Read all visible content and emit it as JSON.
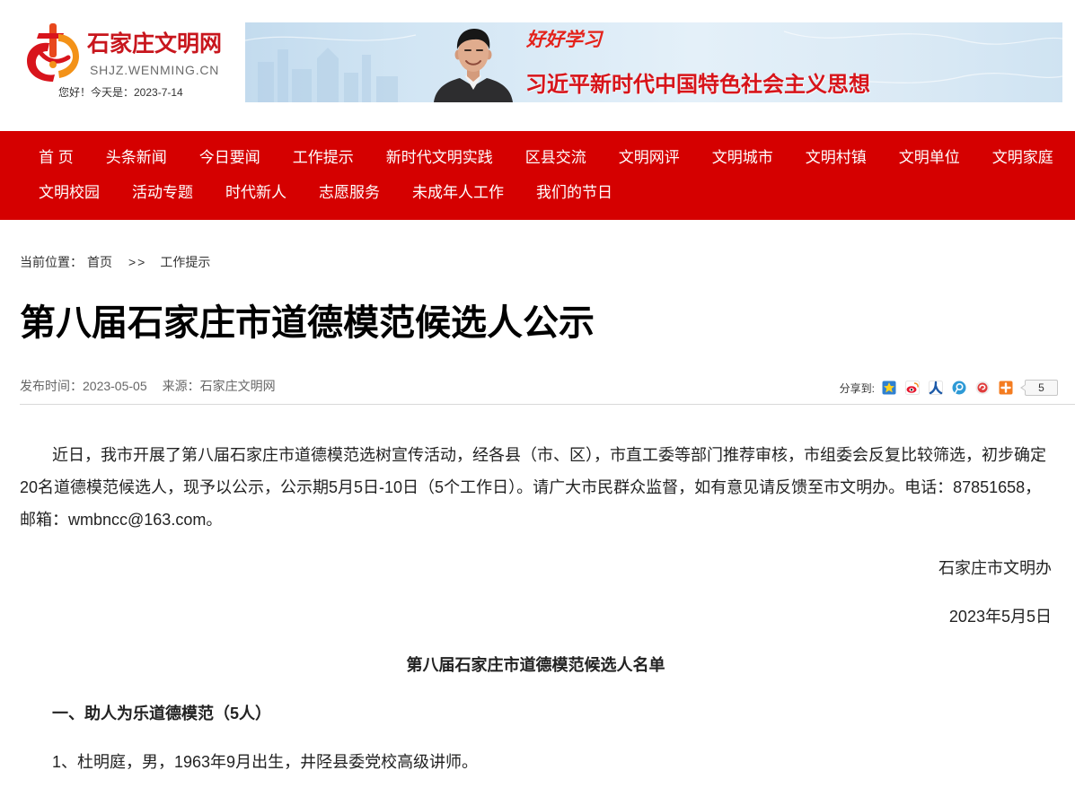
{
  "header": {
    "site_name": "石家庄文明网",
    "site_domain": "SHJZ.WENMING.CN",
    "greeting": "您好！今天是：2023-7-14",
    "banner": {
      "slogan_top": "好好学习",
      "slogan_main": "习近平新时代中国特色社会主义思想"
    }
  },
  "nav": {
    "row1": [
      "首 页",
      "头条新闻",
      "今日要闻",
      "工作提示",
      "新时代文明实践",
      "区县交流",
      "文明网评",
      "文明城市",
      "文明村镇",
      "文明单位",
      "文明家庭"
    ],
    "row2": [
      "文明校园",
      "活动专题",
      "时代新人",
      "志愿服务",
      "未成年人工作",
      "我们的节日"
    ]
  },
  "breadcrumb": {
    "prefix": "当前位置：",
    "home": "首页",
    "separator": ">>",
    "current": "工作提示"
  },
  "article": {
    "title": "第八届石家庄市道德模范候选人公示",
    "publish_label": "发布时间：",
    "publish_date": "2023-05-05",
    "source_label": "来源：",
    "source": "石家庄文明网",
    "intro": "近日，我市开展了第八届石家庄市道德模范选树宣传活动，经各县（市、区），市直工委等部门推荐审核，市组委会反复比较筛选，初步确定20名道德模范候选人，现予以公示，公示期5月5日-10日（5个工作日）。请广大市民群众监督，如有意见请反馈至市文明办。电话：87851658，邮箱：wmbncc@163.com。",
    "signature": "石家庄市文明办",
    "date": "2023年5月5日",
    "list_title": "第八届石家庄市道德模范候选人名单",
    "section_heading": "一、助人为乐道德模范（5人）",
    "candidates": [
      "1、杜明庭，男，1963年9月出生，井陉县委党校高级讲师。"
    ]
  },
  "share": {
    "label": "分享到:",
    "count": "5",
    "icons": [
      "qzone-icon",
      "weibo-icon",
      "renren-icon",
      "tencent-weibo-icon",
      "red-swirl-share-icon",
      "more-plus-icon"
    ]
  },
  "colors": {
    "nav_background": "#d50000",
    "brand_red": "#c8161d",
    "banner_text_red": "#d7141a",
    "logo_orange": "#f39218"
  }
}
